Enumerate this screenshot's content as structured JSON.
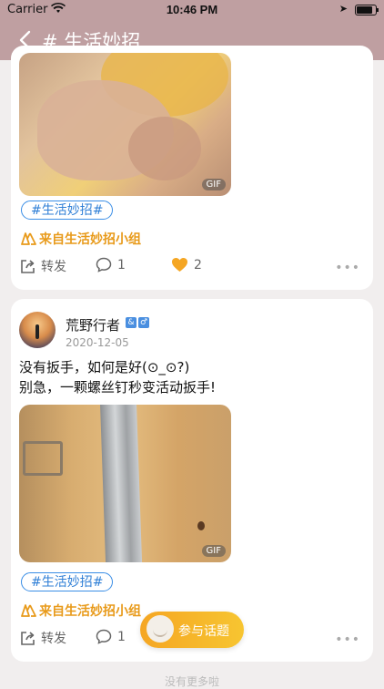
{
  "status": {
    "carrier": "Carrier",
    "time": "10:46 PM"
  },
  "nav": {
    "title": "# 生活妙招"
  },
  "posts": [
    {
      "gif_label": "GIF",
      "tag": "#生活妙招#",
      "group": "来自生活妙招小组",
      "share": "转发",
      "comments": "1",
      "likes": "2"
    },
    {
      "user": "荒野行者",
      "date": "2020-12-05",
      "text1": "没有扳手，如何是好(⊙_⊙?)",
      "text2": "别急，一颗螺丝钉秒变活动扳手!",
      "gif_label": "GIF",
      "tag": "#生活妙招#",
      "group": "来自生活妙招小组",
      "share": "转发",
      "comments": "1"
    }
  ],
  "fab": {
    "label": "参与话题"
  },
  "footer": {
    "note": "没有更多啦"
  },
  "colors": {
    "nav_bg": "#bf9fa1",
    "accent_orange": "#e89a1a",
    "tag_blue": "#2f7fd6",
    "like": "#f5a623"
  }
}
